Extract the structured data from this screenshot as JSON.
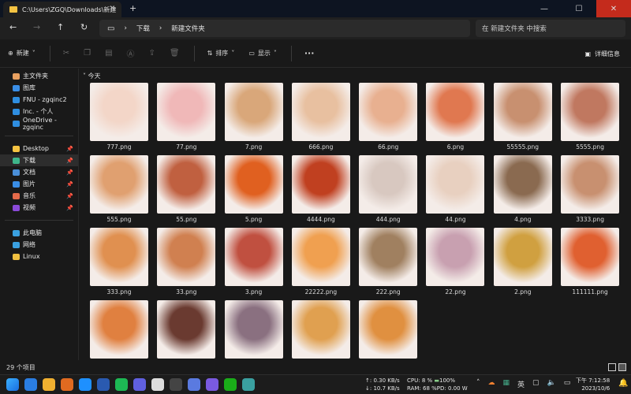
{
  "window": {
    "tab_title": "C:\\Users\\ZGQ\\Downloads\\新建",
    "new_tab": "+",
    "minimize": "—",
    "maximize": "☐",
    "close": "✕"
  },
  "address": {
    "breadcrumb": [
      "下载",
      "新建文件夹"
    ],
    "search_placeholder": "在 新建文件夹 中搜索"
  },
  "toolbar": {
    "new": "新建",
    "sort": "排序",
    "view": "显示",
    "more": "···",
    "details": "详细信息"
  },
  "sidebar": {
    "top": [
      {
        "label": "主文件夹",
        "icon": "home-icon",
        "color": "#e8a060"
      },
      {
        "label": "图库",
        "icon": "gallery-icon",
        "color": "#3a8ee6"
      },
      {
        "label": "FNU - zgqinc2",
        "icon": "cloud-icon",
        "color": "#2f8ee0"
      },
      {
        "label": "Inc. - 个人",
        "icon": "cloud-icon",
        "color": "#2f8ee0"
      },
      {
        "label": "OneDrive - zgqinc",
        "icon": "cloud-icon",
        "color": "#2f8ee0"
      }
    ],
    "pinned": [
      {
        "label": "Desktop",
        "icon": "folder-icon",
        "color": "#f5c342"
      },
      {
        "label": "下载",
        "icon": "download-icon",
        "color": "#3fb68b",
        "selected": true
      },
      {
        "label": "文档",
        "icon": "document-icon",
        "color": "#4a8fd8"
      },
      {
        "label": "图片",
        "icon": "pictures-icon",
        "color": "#3a8ee6"
      },
      {
        "label": "音乐",
        "icon": "music-icon",
        "color": "#e46a4a"
      },
      {
        "label": "视频",
        "icon": "video-icon",
        "color": "#8a4ad8"
      }
    ],
    "devices": [
      {
        "label": "此电脑",
        "icon": "computer-icon",
        "color": "#3aa0e0"
      },
      {
        "label": "网络",
        "icon": "network-icon",
        "color": "#3aa0e0"
      },
      {
        "label": "Linux",
        "icon": "linux-icon",
        "color": "#f0c040"
      }
    ]
  },
  "main": {
    "group_label": "今天",
    "files": [
      {
        "name": "777.png",
        "color": "#f3d6c8"
      },
      {
        "name": "77.png",
        "color": "#f0b8b8"
      },
      {
        "name": "7.png",
        "color": "#d9a77a"
      },
      {
        "name": "666.png",
        "color": "#e8c0a0"
      },
      {
        "name": "66.png",
        "color": "#e8b090"
      },
      {
        "name": "6.png",
        "color": "#e07850"
      },
      {
        "name": "55555.png",
        "color": "#c89070"
      },
      {
        "name": "5555.png",
        "color": "#c07860"
      },
      {
        "name": "555.png",
        "color": "#e0a070"
      },
      {
        "name": "55.png",
        "color": "#c06040"
      },
      {
        "name": "5.png",
        "color": "#e06020"
      },
      {
        "name": "4444.png",
        "color": "#c04020"
      },
      {
        "name": "444.png",
        "color": "#d8c8c0"
      },
      {
        "name": "44.png",
        "color": "#e8d0c0"
      },
      {
        "name": "4.png",
        "color": "#8a6a50"
      },
      {
        "name": "3333.png",
        "color": "#c89070"
      },
      {
        "name": "333.png",
        "color": "#e09050"
      },
      {
        "name": "33.png",
        "color": "#d08050"
      },
      {
        "name": "3.png",
        "color": "#c05040"
      },
      {
        "name": "22222.png",
        "color": "#f0a050"
      },
      {
        "name": "222.png",
        "color": "#a08060"
      },
      {
        "name": "22.png",
        "color": "#c8a0b0"
      },
      {
        "name": "2.png",
        "color": "#d0a040"
      },
      {
        "name": "111111.png",
        "color": "#e06030"
      },
      {
        "name": "",
        "color": "#e08040"
      },
      {
        "name": "",
        "color": "#6a3a30"
      },
      {
        "name": "",
        "color": "#8a7080"
      },
      {
        "name": "",
        "color": "#e0a050"
      },
      {
        "name": "",
        "color": "#e09040"
      }
    ]
  },
  "status": {
    "count": "29 个项目"
  },
  "taskbar": {
    "net_up": "↑: 0.30 KB/s",
    "net_down": "↓: 10.7 KB/s",
    "cpu": "CPU: 8 %",
    "battery": "100%",
    "ram": "RAM: 68 %",
    "power": "PD: 0.00 W",
    "ime": "英",
    "time": "下午 7:12:58",
    "date": "2023/10/6",
    "apps": [
      "#2a7de1",
      "#f0b030",
      "#e06a20",
      "#1e90ff",
      "#2a5ab0",
      "#1db954",
      "#6060e0",
      "#dddddd",
      "#444444",
      "#5a7ae0",
      "#7a5ae0",
      "#1aad19",
      "#3aa0a0"
    ]
  }
}
